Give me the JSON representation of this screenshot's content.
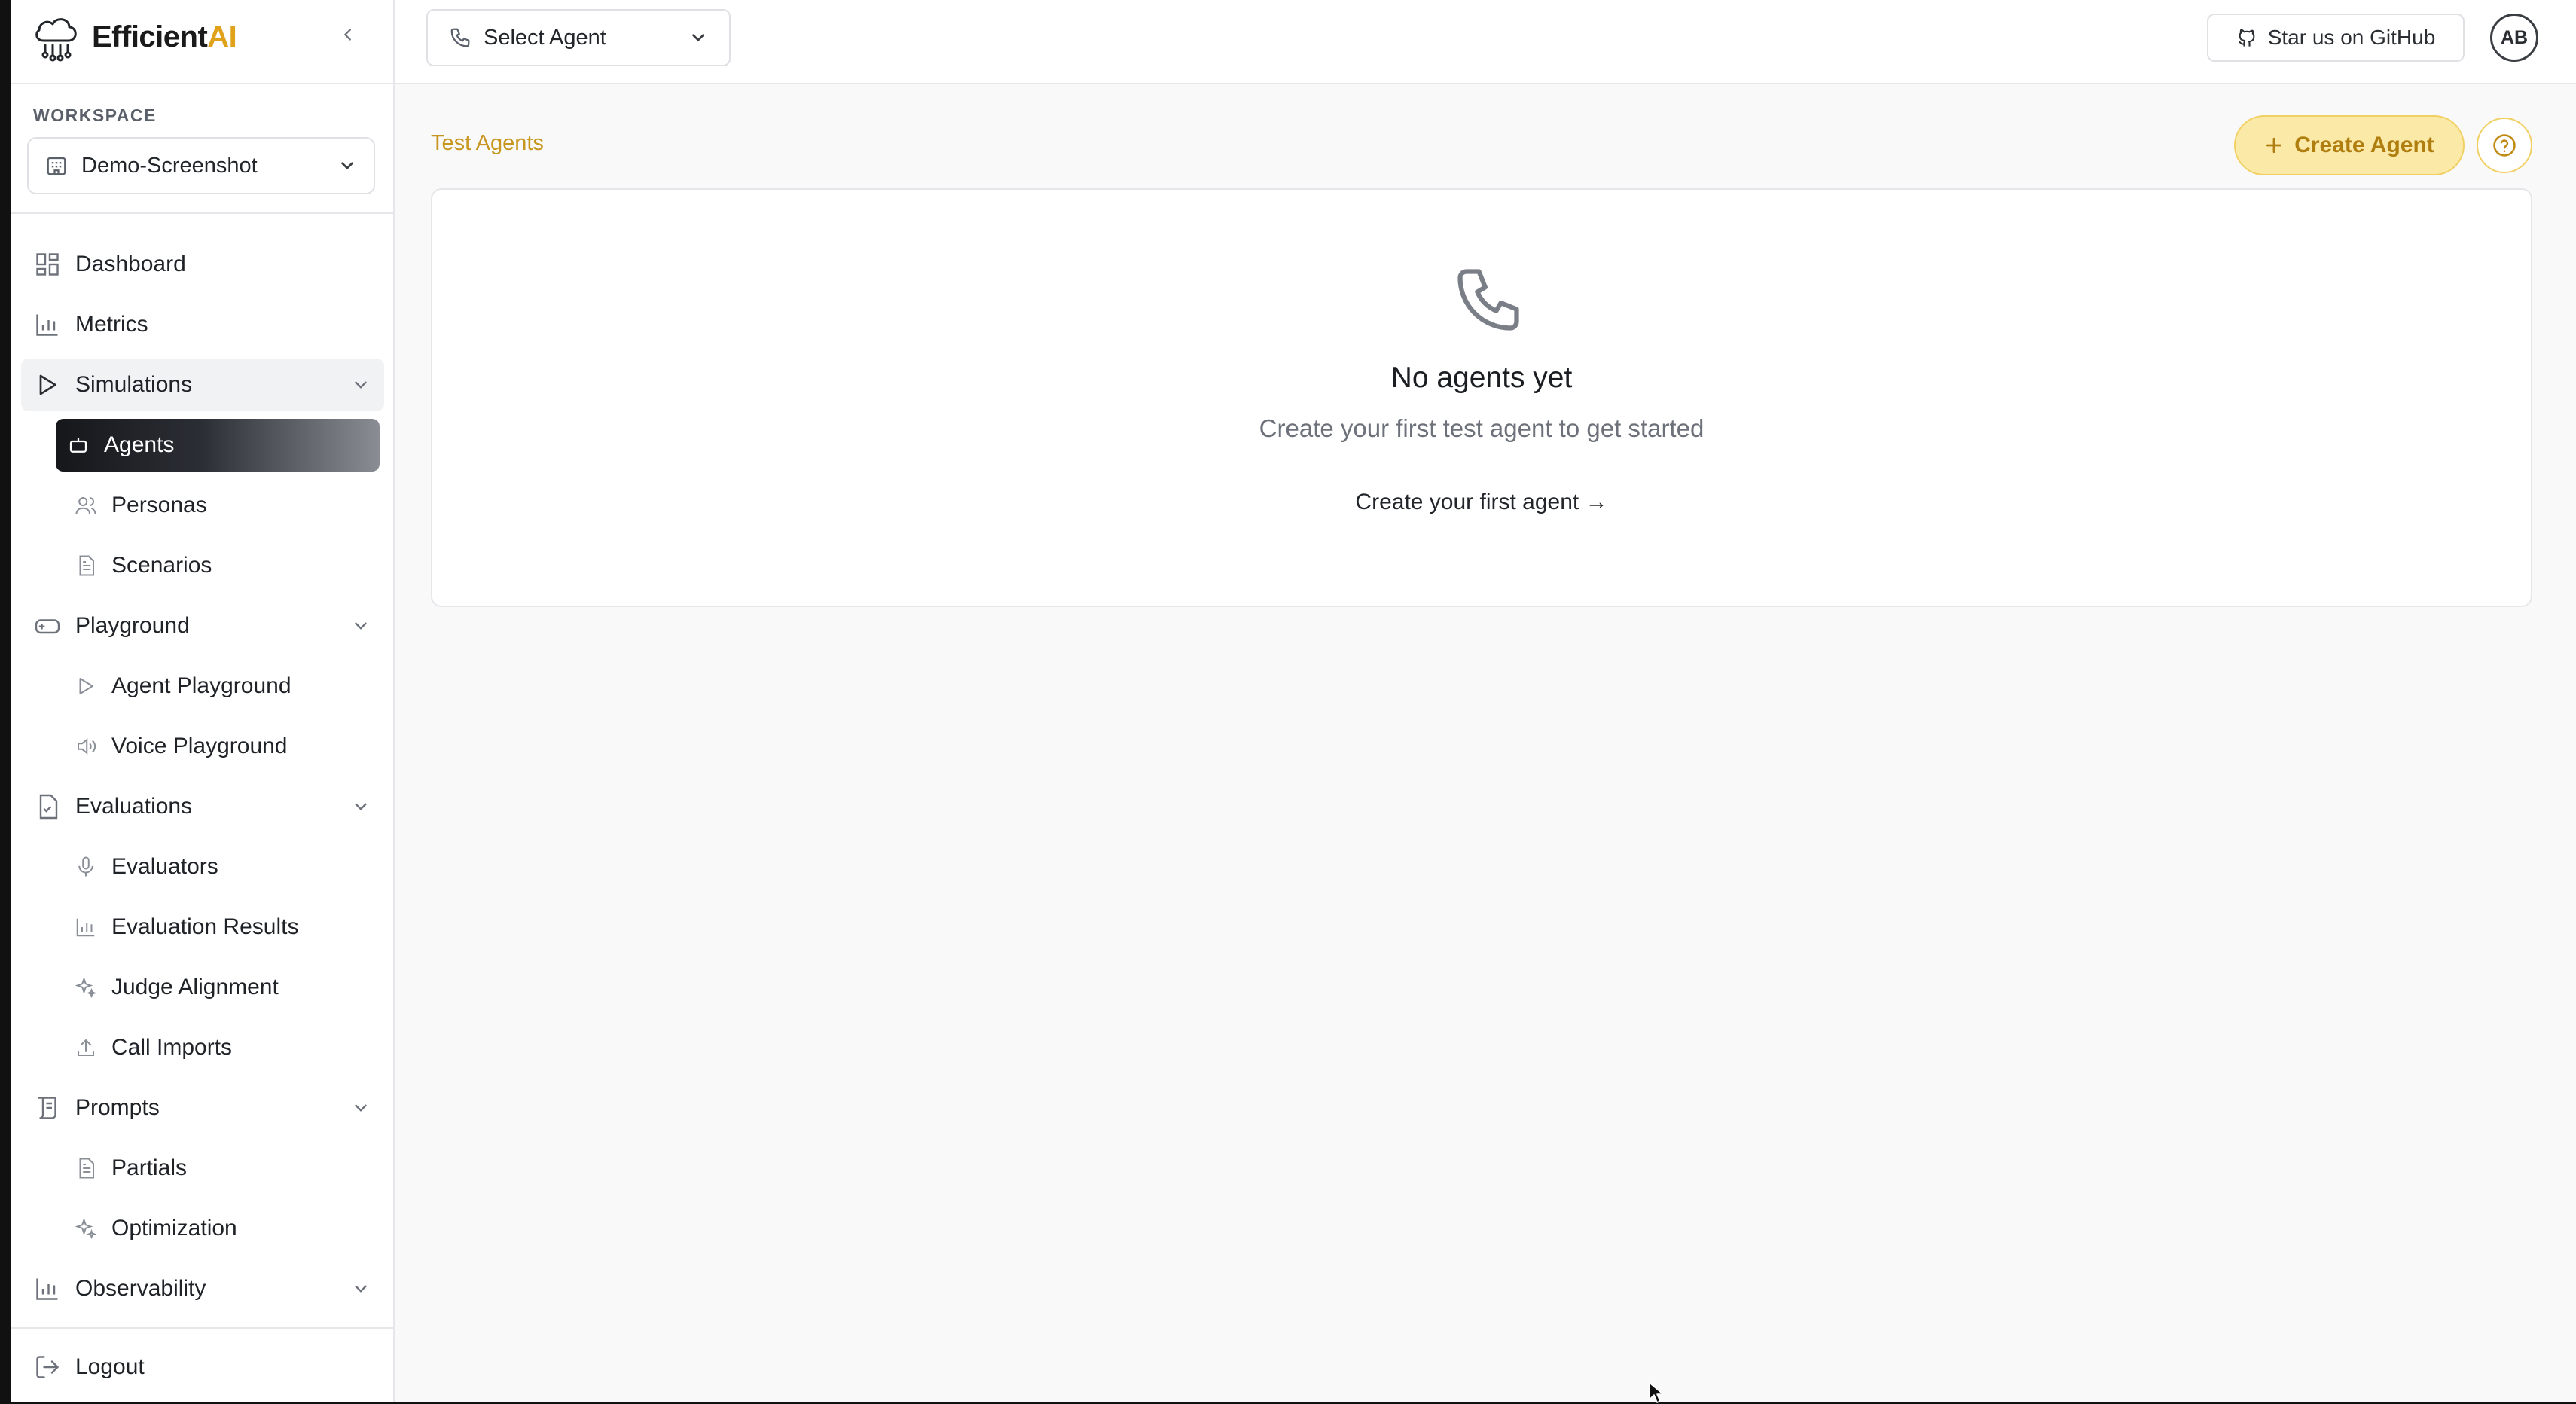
{
  "brand": {
    "name_main": "Efficient",
    "name_accent": "AI",
    "accent_color": "#e0a21b"
  },
  "sidebar": {
    "workspace_label": "WORKSPACE",
    "workspace_value": "Demo-Screenshot",
    "items": [
      {
        "label": "Dashboard",
        "icon": "dashboard-icon"
      },
      {
        "label": "Metrics",
        "icon": "bar-chart-icon"
      },
      {
        "label": "Simulations",
        "icon": "play-icon"
      },
      {
        "label": "Agents",
        "icon": "bot-icon"
      },
      {
        "label": "Personas",
        "icon": "users-icon"
      },
      {
        "label": "Scenarios",
        "icon": "document-icon"
      },
      {
        "label": "Playground",
        "icon": "gamepad-icon"
      },
      {
        "label": "Agent Playground",
        "icon": "play-icon"
      },
      {
        "label": "Voice Playground",
        "icon": "speaker-icon"
      },
      {
        "label": "Evaluations",
        "icon": "file-check-icon"
      },
      {
        "label": "Evaluators",
        "icon": "microphone-icon"
      },
      {
        "label": "Evaluation Results",
        "icon": "bar-chart-icon"
      },
      {
        "label": "Judge Alignment",
        "icon": "sparkles-icon"
      },
      {
        "label": "Call Imports",
        "icon": "upload-icon"
      },
      {
        "label": "Prompts",
        "icon": "scroll-icon"
      },
      {
        "label": "Partials",
        "icon": "document-icon"
      },
      {
        "label": "Optimization",
        "icon": "sparkles-icon"
      },
      {
        "label": "Observability",
        "icon": "bar-chart-icon"
      }
    ],
    "logout_label": "Logout"
  },
  "topbar": {
    "agent_select_label": "Select Agent",
    "github_label": "Star us on GitHub",
    "avatar_initials": "AB"
  },
  "main": {
    "breadcrumb": "Test Agents",
    "create_button_label": "Create Agent",
    "empty_title": "No agents yet",
    "empty_subtitle": "Create your first test agent to get started",
    "empty_link": "Create your first agent →"
  }
}
